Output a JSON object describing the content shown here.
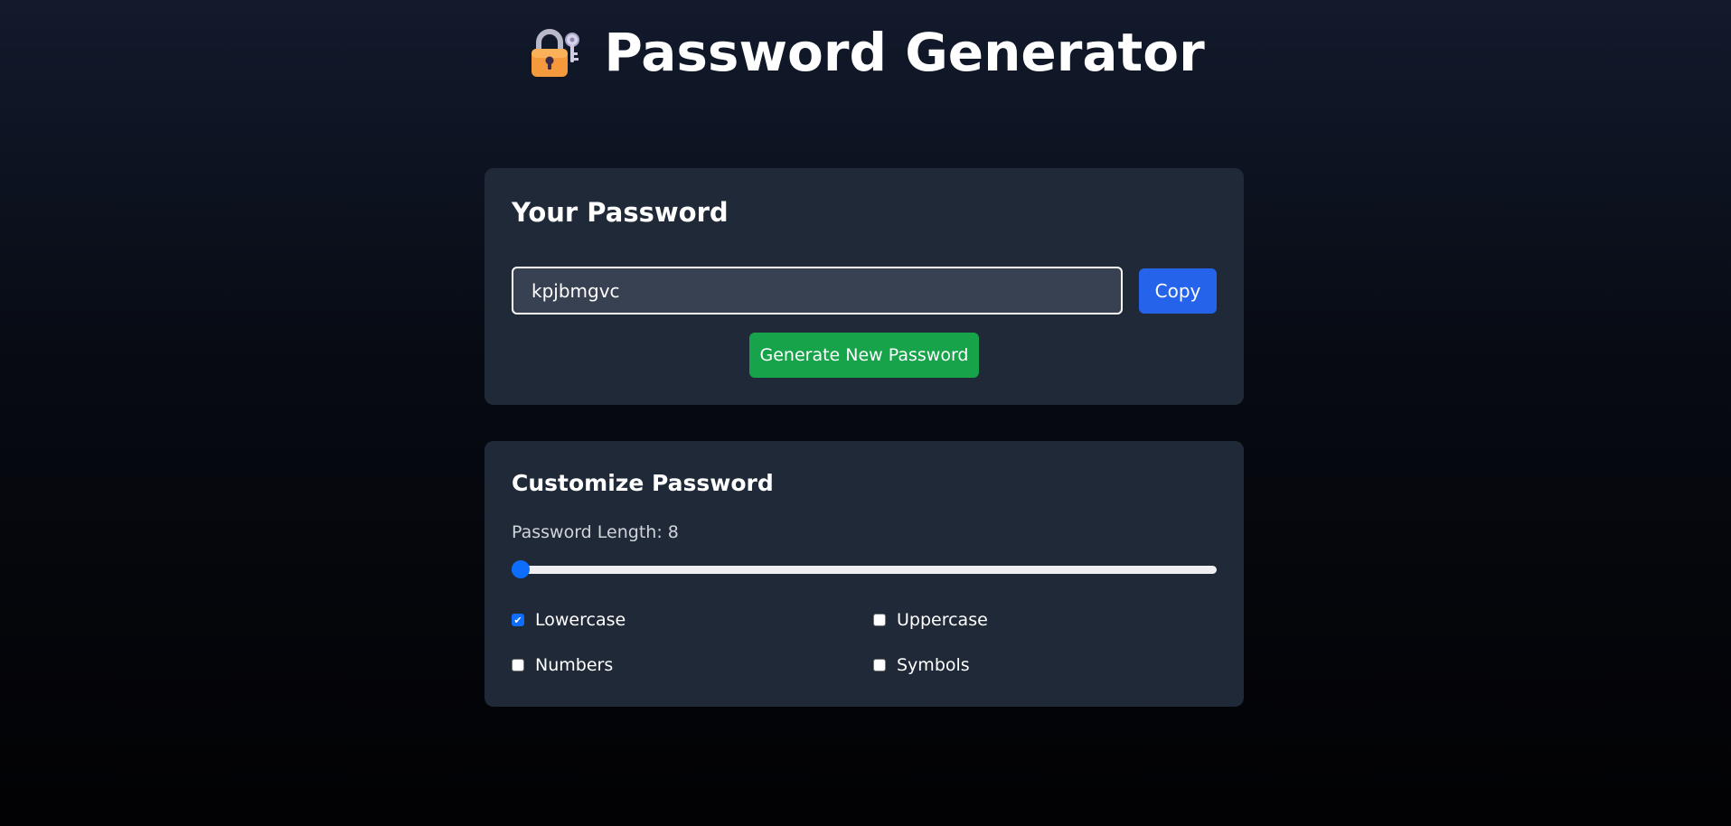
{
  "header": {
    "title": "Password Generator",
    "icon": "lock-with-key-icon"
  },
  "password_card": {
    "heading": "Your Password",
    "password_value": "kpjbmgvc",
    "copy_label": "Copy",
    "generate_label": "Generate New Password"
  },
  "customize_card": {
    "heading": "Customize Password",
    "length_label": "Password Length: 8",
    "length_slider": {
      "value": 8,
      "fill_fraction": 0.0
    },
    "options": [
      {
        "label": "Lowercase",
        "checked": true
      },
      {
        "label": "Uppercase",
        "checked": false
      },
      {
        "label": "Numbers",
        "checked": false
      },
      {
        "label": "Symbols",
        "checked": false
      }
    ]
  },
  "colors": {
    "card_background": "#1f2937",
    "input_background": "#374151",
    "copy_button": "#2563eb",
    "generate_button": "#16a34a",
    "accent": "#0d6efd"
  }
}
